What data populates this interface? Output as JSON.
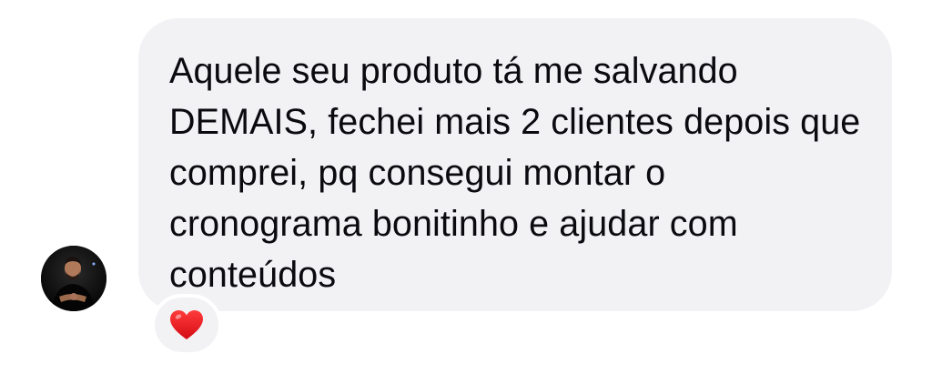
{
  "message": {
    "text": "Aquele seu produto tá me salvando DEMAIS, fechei mais 2 clientes depois que comprei, pq consegui montar o cronograma bonitinho e ajudar com conteúdos",
    "bubble_color": "#f2f2f5",
    "text_color": "#0b0b0f"
  },
  "sender": {
    "avatar_icon": "person-avatar"
  },
  "reaction": {
    "icon": "heart-icon",
    "color": "#e0141b"
  }
}
